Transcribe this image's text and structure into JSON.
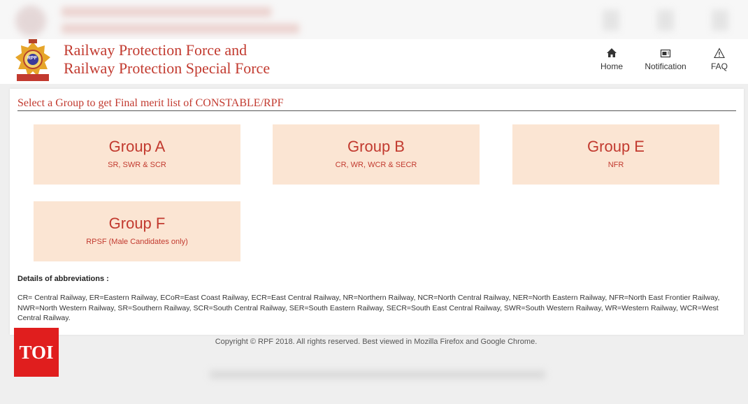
{
  "header": {
    "title_line1": "Railway Protection Force and",
    "title_line2": "Railway Protection Special Force",
    "logo_text": "RPF",
    "nav": [
      {
        "label": "Home",
        "icon": "home-icon"
      },
      {
        "label": "Notification",
        "icon": "notification-icon"
      },
      {
        "label": "FAQ",
        "icon": "warning-icon"
      }
    ]
  },
  "main": {
    "section_title": "Select a Group to get Final merit list of CONSTABLE/RPF",
    "groups": [
      {
        "name": "Group A",
        "zones": "SR, SWR & SCR"
      },
      {
        "name": "Group B",
        "zones": "CR, WR, WCR & SECR"
      },
      {
        "name": "Group E",
        "zones": "NFR"
      },
      {
        "name": "Group F",
        "zones": "RPSF (Male Candidates only)"
      }
    ],
    "abbr_heading": "Details of abbreviations :",
    "abbr_text": "CR= Central Railway, ER=Eastern Railway, ECoR=East Coast Railway, ECR=East Central Railway, NR=Northern Railway, NCR=North Central Railway, NER=North Eastern Railway, NFR=North East Frontier Railway, NWR=North Western Railway, SR=Southern Railway, SCR=South Central Railway, SER=South Eastern Railway, SECR=South East Central Railway, SWR=South Western Railway, WR=Western Railway, WCR=West Central Railway."
  },
  "footer": {
    "copyright": "Copyright © RPF 2018. All rights reserved. Best viewed in Mozilla Firefox and Google Chrome."
  },
  "watermark": {
    "label": "TOI"
  },
  "colors": {
    "accent": "#c23a2f",
    "card_bg": "#fbe5d3",
    "watermark": "#e01e1e"
  }
}
